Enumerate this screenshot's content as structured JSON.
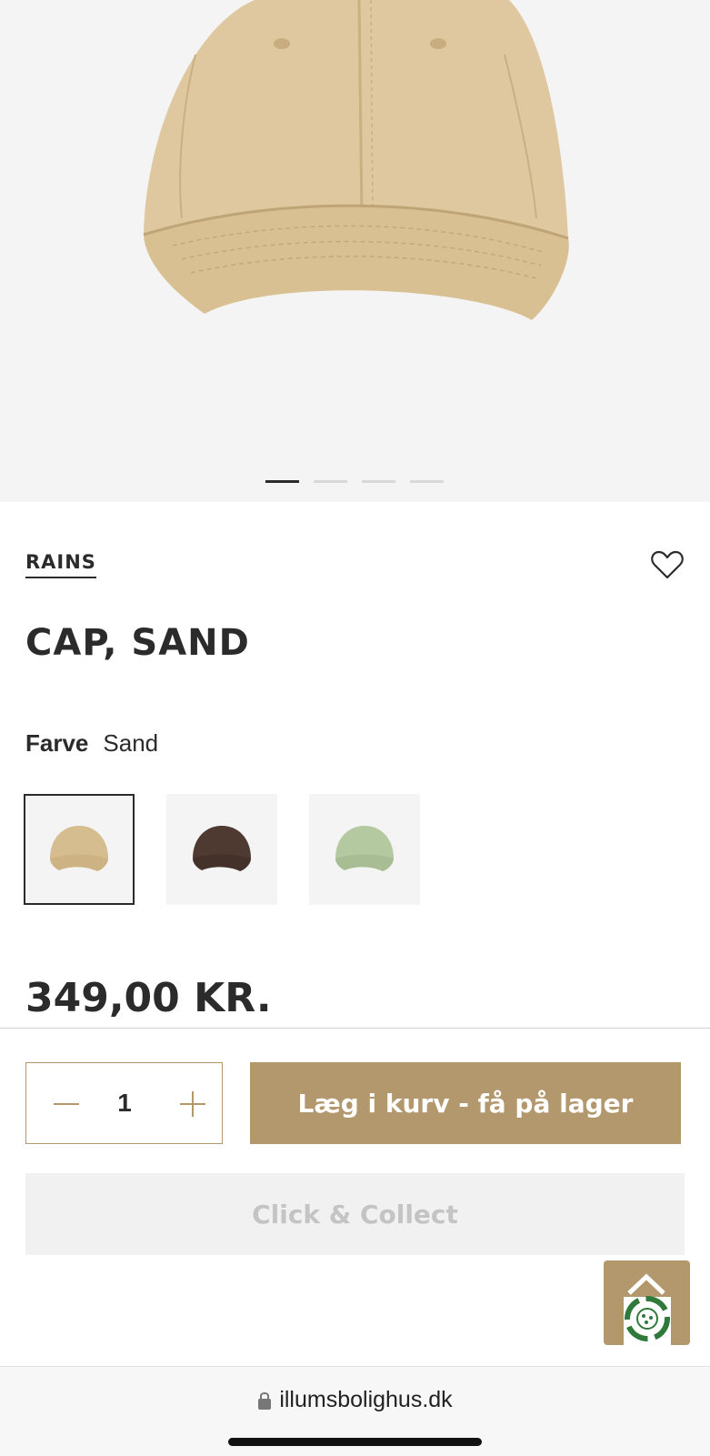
{
  "gallery": {
    "total_images": 4,
    "active_index": 0
  },
  "product": {
    "brand": "RAINS",
    "title": "CAP, SAND",
    "color_label": "Farve",
    "color_value": "Sand",
    "swatches": [
      {
        "name": "Sand",
        "color": "#d6bd8f",
        "selected": true
      },
      {
        "name": "Brown",
        "color": "#4e3a31",
        "selected": false
      },
      {
        "name": "Green",
        "color": "#b5c9a0",
        "selected": false
      }
    ],
    "price": "349,00 KR."
  },
  "cart": {
    "quantity": "1",
    "add_label": "Læg i kurv - få på lager",
    "click_collect_label": "Click & Collect"
  },
  "browser": {
    "url": "illumsbolighus.dk"
  },
  "colors": {
    "accent": "#b3976d",
    "text": "#2b2b2b",
    "hero_bg": "#f4f4f4"
  },
  "icons": [
    "heart-icon",
    "minus-icon",
    "plus-icon",
    "lock-icon",
    "recycle-badge-icon",
    "chevron-up-icon"
  ]
}
